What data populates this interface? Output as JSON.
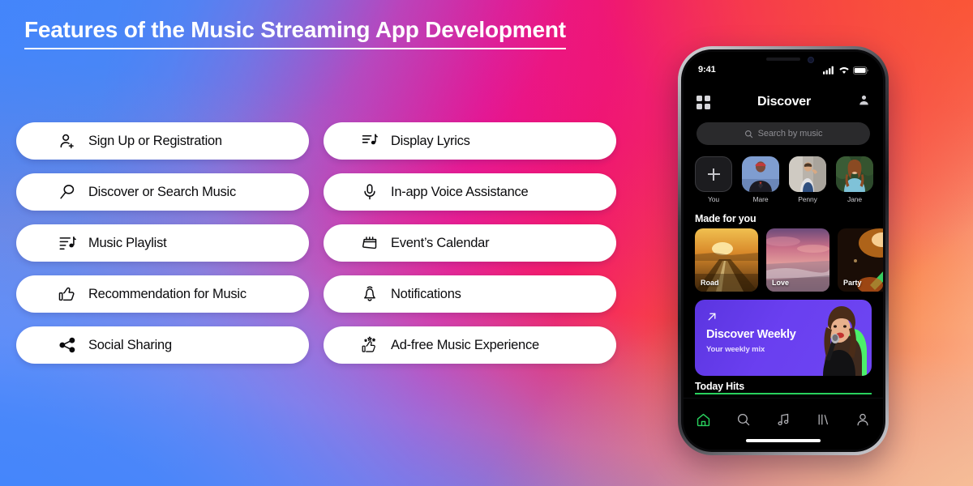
{
  "page": {
    "title": "Features of the Music Streaming App Development",
    "background": {
      "blue": "#4285fc",
      "purple": "#8272e0",
      "magenta": "#e6169a",
      "red": "#fa3f3c",
      "orange": "#fb6336",
      "peach": "#fcc08c"
    }
  },
  "features": {
    "left": [
      {
        "label": "Sign Up or Registration",
        "icon": "user-add-icon"
      },
      {
        "label": "Discover or Search Music",
        "icon": "search-icon"
      },
      {
        "label": "Music Playlist",
        "icon": "playlist-music-icon"
      },
      {
        "label": "Recommendation for Music",
        "icon": "thumbs-up-icon"
      },
      {
        "label": "Social Sharing",
        "icon": "share-icon"
      }
    ],
    "right": [
      {
        "label": "Display Lyrics",
        "icon": "lyrics-note-icon"
      },
      {
        "label": "In-app Voice Assistance",
        "icon": "microphone-icon"
      },
      {
        "label": "Event’s Calendar",
        "icon": "calendar-icon"
      },
      {
        "label": "Notifications",
        "icon": "bell-icon"
      },
      {
        "label": "Ad-free Music Experience",
        "icon": "thumbs-up-stars-icon"
      }
    ]
  },
  "phone": {
    "status_bar": {
      "time": "9:41",
      "cellular": "signal-icon",
      "wifi": "wifi-icon",
      "battery": "battery-icon"
    },
    "header": {
      "menu_icon": "grid-menu-icon",
      "title": "Discover",
      "profile_icon": "person-icon"
    },
    "search": {
      "placeholder": "Search by music",
      "icon": "search-icon"
    },
    "stories": [
      {
        "name": "You",
        "type": "add"
      },
      {
        "name": "Mare",
        "type": "photo"
      },
      {
        "name": "Penny",
        "type": "photo"
      },
      {
        "name": "Jane",
        "type": "photo"
      }
    ],
    "made_for_you": {
      "title": "Made for you",
      "cards": [
        {
          "label": "Road"
        },
        {
          "label": "Love"
        },
        {
          "label": "Party"
        }
      ]
    },
    "banner": {
      "title": "Discover Weekly",
      "subtitle": "Your weekly mix",
      "icon": "arrow-up-right-icon",
      "accent": "#6a3ff0",
      "outline": "#4cf06a"
    },
    "next_section": {
      "title": "Today Hits",
      "accent": "#29d15e"
    },
    "tabbar": [
      {
        "name": "home",
        "icon": "home-icon",
        "active": true
      },
      {
        "name": "search",
        "icon": "search-icon",
        "active": false
      },
      {
        "name": "music",
        "icon": "music-note-icon",
        "active": false
      },
      {
        "name": "library",
        "icon": "library-icon",
        "active": false
      },
      {
        "name": "profile",
        "icon": "person-icon",
        "active": false
      }
    ]
  }
}
